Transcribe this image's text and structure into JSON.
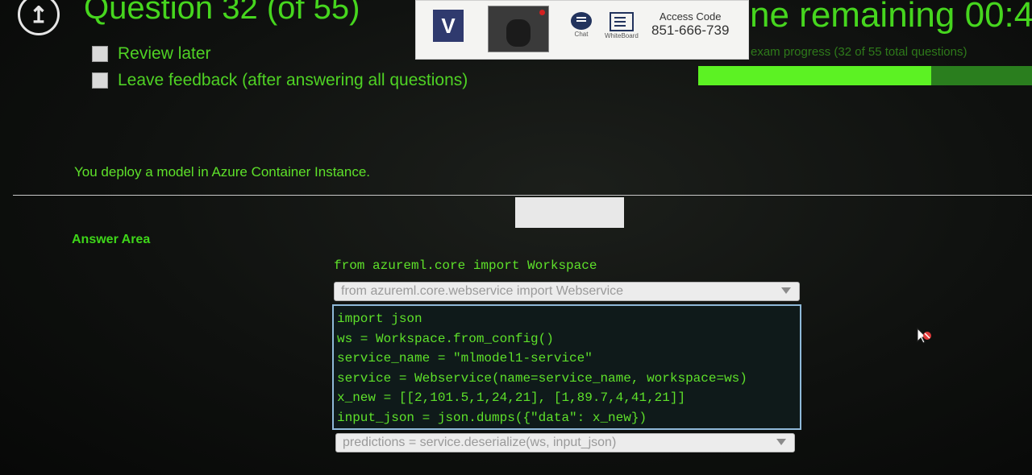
{
  "header": {
    "back_icon": "up-arrow-circle-icon",
    "question_title": "Question 32 (of 55)",
    "review_later_label": "Review later",
    "leave_feedback_label": "Leave feedback (after answering all questions)",
    "time_remaining_label": "ne remaining 00:4",
    "progress_label": "exam progress (32 of 55 total questions)",
    "progress_fraction": 0.698
  },
  "proctor_panel": {
    "logo_letter": "V",
    "chat_label": "Chat",
    "whiteboard_label": "WhiteBoard",
    "access_code_title": "Access Code",
    "access_code_value": "851-666-739"
  },
  "question": {
    "statement": "You deploy a model in Azure Container Instance."
  },
  "answer_area": {
    "title": "Answer Area",
    "static_line": "from azureml.core import Workspace",
    "dropdown_1_value": "from azureml.core.webservice import Webservice",
    "code_lines": [
      "import json",
      "ws = Workspace.from_config()",
      "service_name = \"mlmodel1-service\"",
      "service = Webservice(name=service_name, workspace=ws)",
      "x_new = [[2,101.5,1,24,21], [1,89.7,4,41,21]]",
      "input_json = json.dumps({\"data\": x_new})"
    ],
    "dropdown_2_value": "predictions = service.deserialize(ws, input_json)"
  },
  "colors": {
    "accent_green": "#5ee12a",
    "progress_fill": "#5cf223",
    "progress_track": "#2a7e1e"
  }
}
